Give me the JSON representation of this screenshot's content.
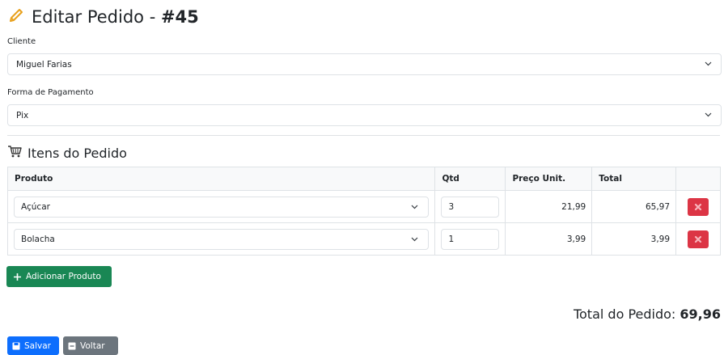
{
  "header": {
    "title": "Editar Pedido - ",
    "order_number": "#45",
    "icon": "pencil-icon",
    "icon_color": "#e8a01b"
  },
  "form": {
    "cliente": {
      "label": "Cliente",
      "value": "Miguel Farias"
    },
    "pagamento": {
      "label": "Forma de Pagamento",
      "value": "Pix"
    }
  },
  "items_section": {
    "title": "Itens do Pedido",
    "icon": "cart-icon",
    "columns": [
      "Produto",
      "Qtd",
      "Preço Unit.",
      "Total",
      ""
    ],
    "rows": [
      {
        "produto": "Açúcar",
        "qtd": "3",
        "preco": "21,99",
        "total": "65,97"
      },
      {
        "produto": "Bolacha",
        "qtd": "1",
        "preco": "3,99",
        "total": "3,99"
      }
    ]
  },
  "buttons": {
    "add_product": "Adicionar Produto",
    "save": "Salvar",
    "back": "Voltar"
  },
  "summary": {
    "label": "Total do Pedido: ",
    "value": "69,96"
  },
  "colors": {
    "success": "#198754",
    "primary": "#0d6efd",
    "secondary": "#6c757d",
    "danger": "#dc3545"
  }
}
